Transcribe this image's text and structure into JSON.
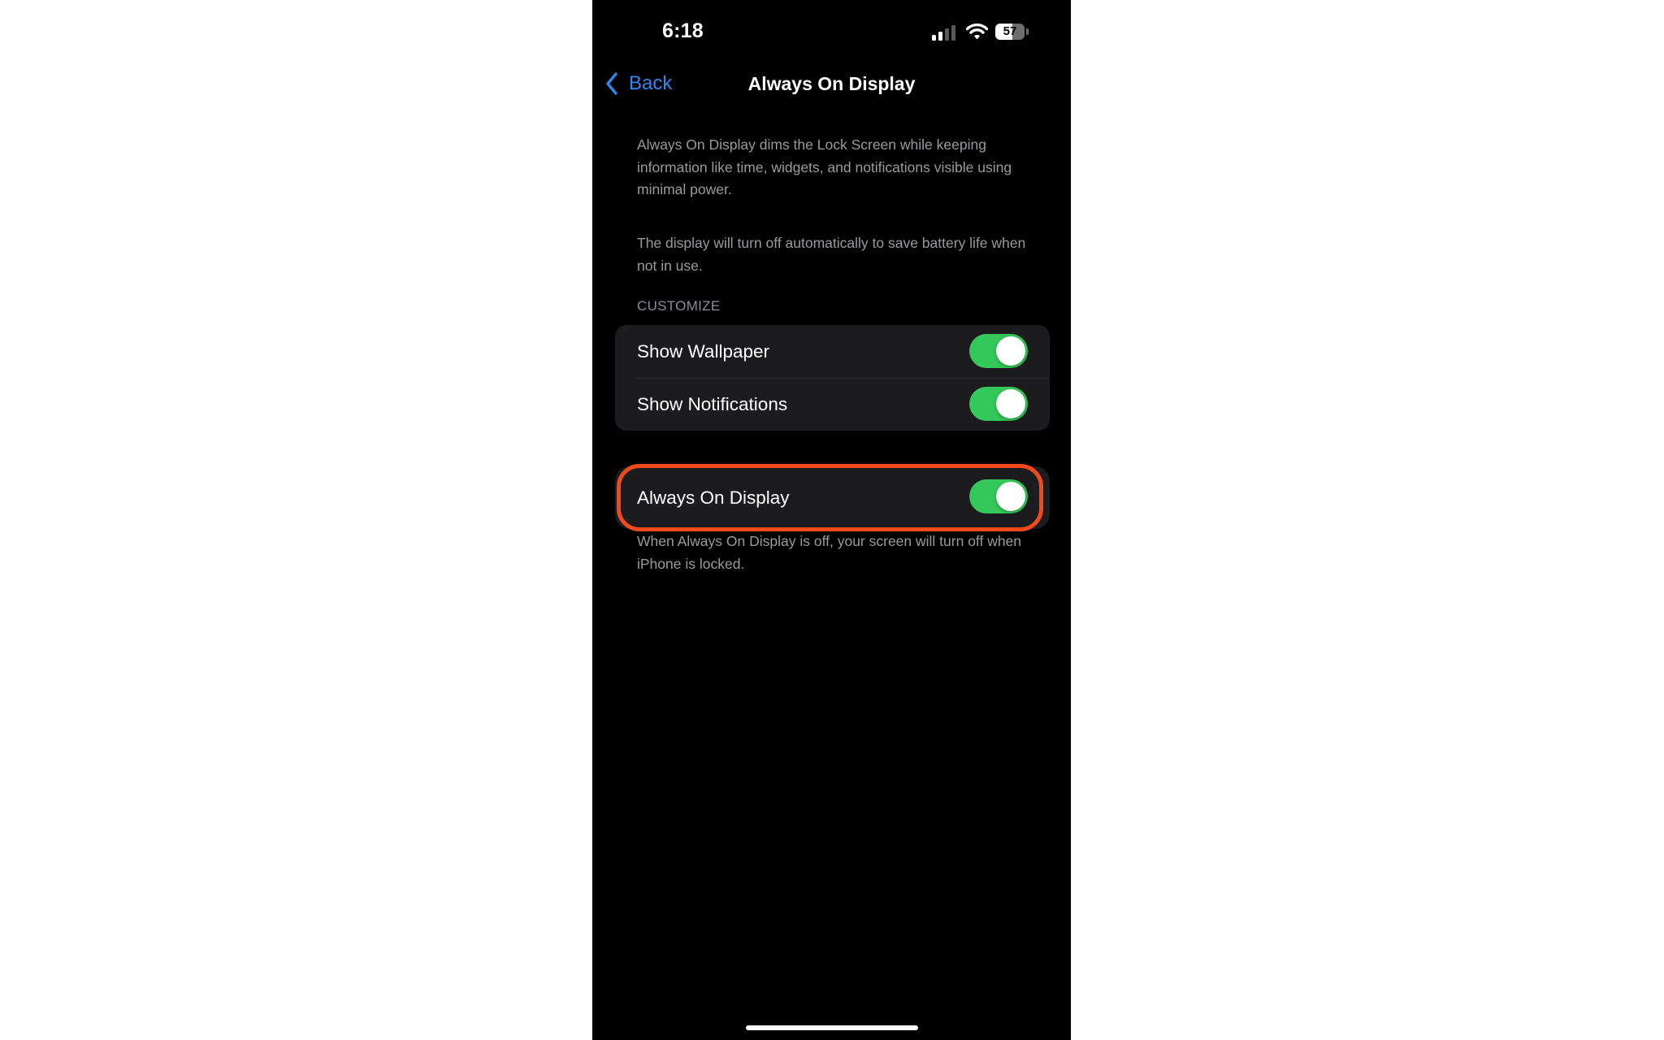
{
  "status_bar": {
    "time": "6:18",
    "battery_percent": "57",
    "battery_level": 0.57,
    "signal_bars_active": 2,
    "signal_bars_total": 4,
    "icons": [
      "cellular-signal-icon",
      "wifi-icon",
      "battery-icon"
    ]
  },
  "nav": {
    "back_label": "Back",
    "back_icon": "chevron-left-icon",
    "title": "Always On Display"
  },
  "description": {
    "paragraph_1": "Always On Display dims the Lock Screen while keeping information like time, widgets, and notifications visible using minimal power.",
    "paragraph_2": "The display will turn off automatically to save battery life when not in use."
  },
  "customize": {
    "header": "CUSTOMIZE",
    "rows": [
      {
        "label": "Show Wallpaper",
        "enabled": true
      },
      {
        "label": "Show Notifications",
        "enabled": true
      }
    ]
  },
  "always_on": {
    "label": "Always On Display",
    "enabled": true,
    "footer": "When Always On Display is off, your screen will turn off when iPhone is locked.",
    "highlighted": true
  },
  "colors": {
    "accent_blue": "#2f86f0",
    "toggle_on": "#34c759",
    "highlight_red": "#f04a1c",
    "cell_background": "#1c1c1e"
  }
}
